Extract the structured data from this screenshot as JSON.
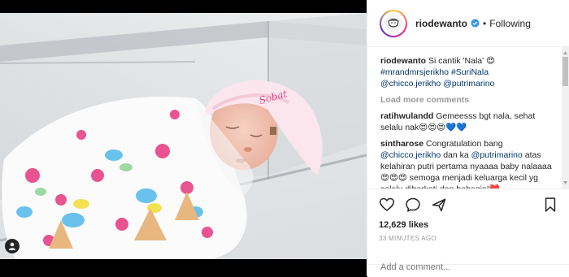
{
  "post": {
    "username": "riodewanto",
    "follow_status": "Following",
    "separator": "•"
  },
  "caption": {
    "user": "riodewanto",
    "text": "Si cantik 'Nala' 😍",
    "hashtags": "#mrandmrsjerikho #SuriNala",
    "mention_1": "@chicco.jerikho",
    "mention_2": "@putrimarino"
  },
  "load_more": "Load more comments",
  "comments": [
    {
      "user": "ratihwulandd",
      "text": "Gemeesss bgt nala, sehat selalu nak😍😍😍💙💙"
    },
    {
      "user": "sintharose",
      "text_1": "Congratulation bang",
      "mention_1": "@chicco.jerikho",
      "text_2": "dan ka",
      "mention_2": "@putrimarino",
      "text_3": "atas kelahiran putri pertama nyaaaa baby nalaaaa😍😍😍 semoga menjadi keluarga kecil yg selalu diberkati dan bahagia!❤️"
    }
  ],
  "likes": "12,629 likes",
  "timestamp": "33 MINUTES AGO",
  "add_comment_placeholder": "Add a comment...",
  "photo": {
    "hat_text": "Sobat"
  },
  "colors": {
    "link": "#003569",
    "verified": "#3897f0",
    "heart": "#ed4956"
  }
}
